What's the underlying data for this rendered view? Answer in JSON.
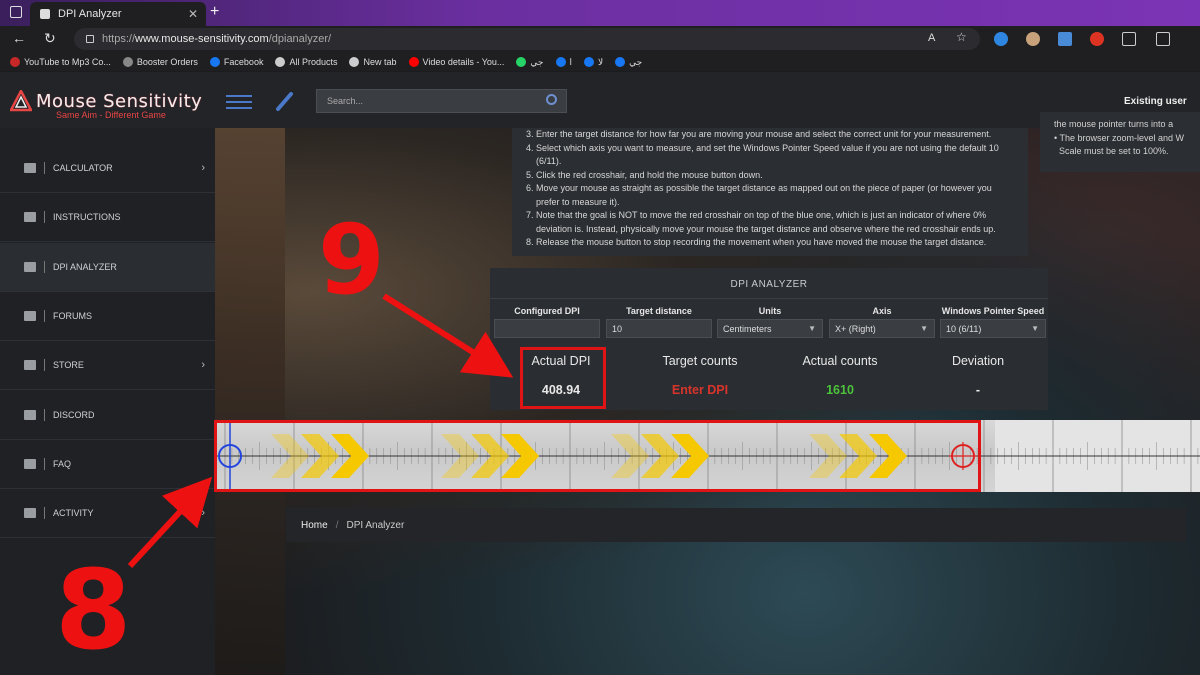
{
  "browser": {
    "tab_title": "DPI Analyzer",
    "url_prefix": "https://",
    "url_host": "www.mouse-sensitivity.com",
    "url_path": "/dpianalyzer/",
    "bookmarks": [
      {
        "label": "YouTube to Mp3 Co...",
        "color": "#c62828"
      },
      {
        "label": "Booster Orders",
        "color": "#888888"
      },
      {
        "label": "Facebook",
        "color": "#1877f2"
      },
      {
        "label": "All Products",
        "color": "#cccccc"
      },
      {
        "label": "New tab",
        "color": "#cccccc"
      },
      {
        "label": "Video details - You...",
        "color": "#ff0000"
      },
      {
        "label": "جي",
        "color": "#25d366"
      },
      {
        "label": "ا",
        "color": "#1877f2"
      },
      {
        "label": "لا",
        "color": "#1877f2"
      },
      {
        "label": "جي",
        "color": "#1877f2"
      }
    ]
  },
  "header": {
    "logo_title": "Mouse Sensitivity",
    "logo_subtitle": "Same Aim - Different Game",
    "search_placeholder": "Search...",
    "existing_user": "Existing user"
  },
  "sidebar": {
    "items": [
      {
        "label": "CALCULATOR",
        "chevron": true
      },
      {
        "label": "INSTRUCTIONS",
        "chevron": false
      },
      {
        "label": "DPI ANALYZER",
        "chevron": false,
        "active": true
      },
      {
        "label": "FORUMS",
        "chevron": false
      },
      {
        "label": "STORE",
        "chevron": true
      },
      {
        "label": "DISCORD",
        "chevron": false
      },
      {
        "label": "FAQ",
        "chevron": false
      },
      {
        "label": "ACTIVITY",
        "chevron": true
      }
    ]
  },
  "instructions": {
    "lines": [
      "3. Enter the target distance for how far you are moving your mouse and select the correct unit for your measurement.",
      "4. Select which axis you want to measure, and set the Windows Pointer Speed value if you are not using the default 10",
      "    (6/11).",
      "5. Click the red crosshair, and hold the mouse button down.",
      "6. Move your mouse as straight as possible the target distance as mapped out on the piece of paper (or however you",
      "    prefer to measure it).",
      "7. Note that the goal is NOT to move the red crosshair on top of the blue one, which is just an indicator of where 0%",
      "    deviation is. Instead, physically move your mouse the target distance and observe where the red crosshair ends up.",
      "8. Release the mouse button to stop recording the movement when you have moved the mouse the target distance."
    ],
    "notes": [
      "the mouse pointer turns into a",
      "• The browser zoom-level and W",
      "  Scale must be set to 100%."
    ]
  },
  "analyzer": {
    "title": "DPI ANALYZER",
    "fields": [
      {
        "label": "Configured DPI",
        "value": "",
        "dropdown": false
      },
      {
        "label": "Target distance",
        "value": "10",
        "dropdown": false
      },
      {
        "label": "Units",
        "value": "Centimeters",
        "dropdown": true
      },
      {
        "label": "Axis",
        "value": "X+ (Right)",
        "dropdown": true
      },
      {
        "label": "Windows Pointer Speed",
        "value": "10 (6/11)",
        "dropdown": true
      }
    ],
    "results": [
      {
        "label": "Actual DPI",
        "value": "408.94",
        "color": "#e8e8e8"
      },
      {
        "label": "Target counts",
        "value": "Enter DPI",
        "color": "#d9342b"
      },
      {
        "label": "Actual counts",
        "value": "1610",
        "color": "#4cc33a"
      },
      {
        "label": "Deviation",
        "value": "-",
        "color": "#e8e8e8"
      }
    ]
  },
  "breadcrumb": {
    "home": "Home",
    "current": "DPI Analyzer"
  },
  "annotations": {
    "step_top": "9",
    "step_bottom": "8",
    "arrow_color": "#ee1111"
  },
  "colors": {
    "accent_red": "#e01414",
    "chevron_yellow": "#f5c800",
    "blue_crosshair": "#2244dd"
  }
}
